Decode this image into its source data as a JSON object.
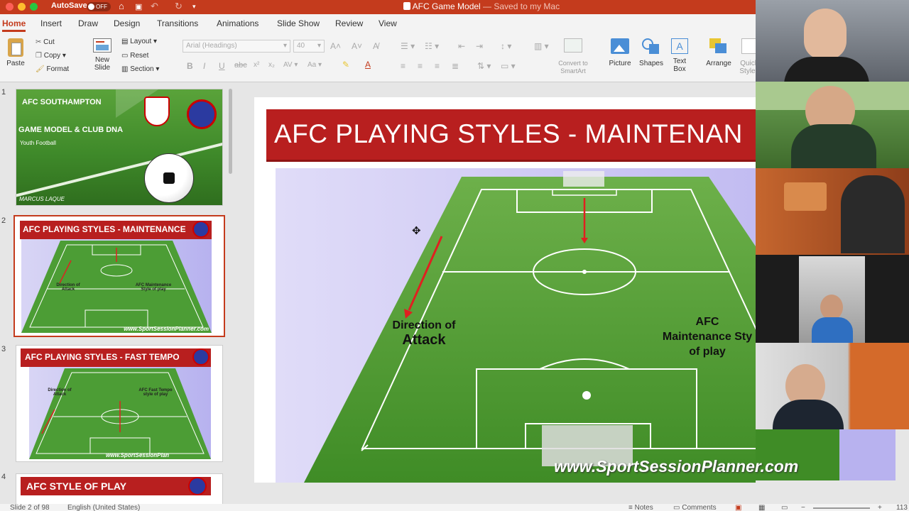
{
  "titlebar": {
    "autosave_label": "AutoSave",
    "autosave_state": "OFF",
    "doc_title": "AFC Game Model",
    "doc_status": "— Saved to my Mac",
    "accent": "#c43b1d"
  },
  "tabs": [
    "Home",
    "Insert",
    "Draw",
    "Design",
    "Transitions",
    "Animations",
    "Slide Show",
    "Review",
    "View"
  ],
  "ribbon": {
    "paste": "Paste",
    "cut": "Cut",
    "copy": "Copy",
    "format": "Format",
    "new_slide": "New\nSlide",
    "layout": "Layout",
    "reset": "Reset",
    "section": "Section",
    "font_name": "Arial (Headings)",
    "font_size": "40",
    "convert_smartart": "Convert to\nSmartArt",
    "picture": "Picture",
    "shapes": "Shapes",
    "text_box": "Text\nBox",
    "arrange": "Arrange",
    "quick_styles": "Quick\nStyles"
  },
  "thumbnails": [
    {
      "number": "1",
      "title": "AFC SOUTHAMPTON",
      "line2": "GAME MODEL & CLUB  DNA",
      "line3": "Youth Football",
      "footer": "MARCUS LAQUE"
    },
    {
      "number": "2",
      "title": "AFC PLAYING STYLES - MAINTENANCE",
      "label_left": "Direction of Attack",
      "label_right": "AFC Maintenance Style of play",
      "footer": "www.SportSessionPlanner.com"
    },
    {
      "number": "3",
      "title": "AFC PLAYING STYLES - FAST TEMPO",
      "label_left": "Direction of Attack",
      "label_right": "AFC Fast Tempo style of play",
      "footer": "www.SportSessionPlan"
    },
    {
      "number": "4",
      "title": "AFC STYLE OF PLAY"
    }
  ],
  "slide": {
    "title": "AFC PLAYING STYLES - MAINTENAN",
    "label_direction_1": "Direction of",
    "label_direction_2": "Attack",
    "label_style_1": "AFC",
    "label_style_2": "Maintenance Sty",
    "label_style_3": "of play",
    "watermark": "www.SportSessionPlanner.com"
  },
  "status": {
    "slide_position": "Slide 2 of 98",
    "language": "English (United States)",
    "notes": "Notes",
    "comments": "Comments",
    "zoom": "113"
  }
}
